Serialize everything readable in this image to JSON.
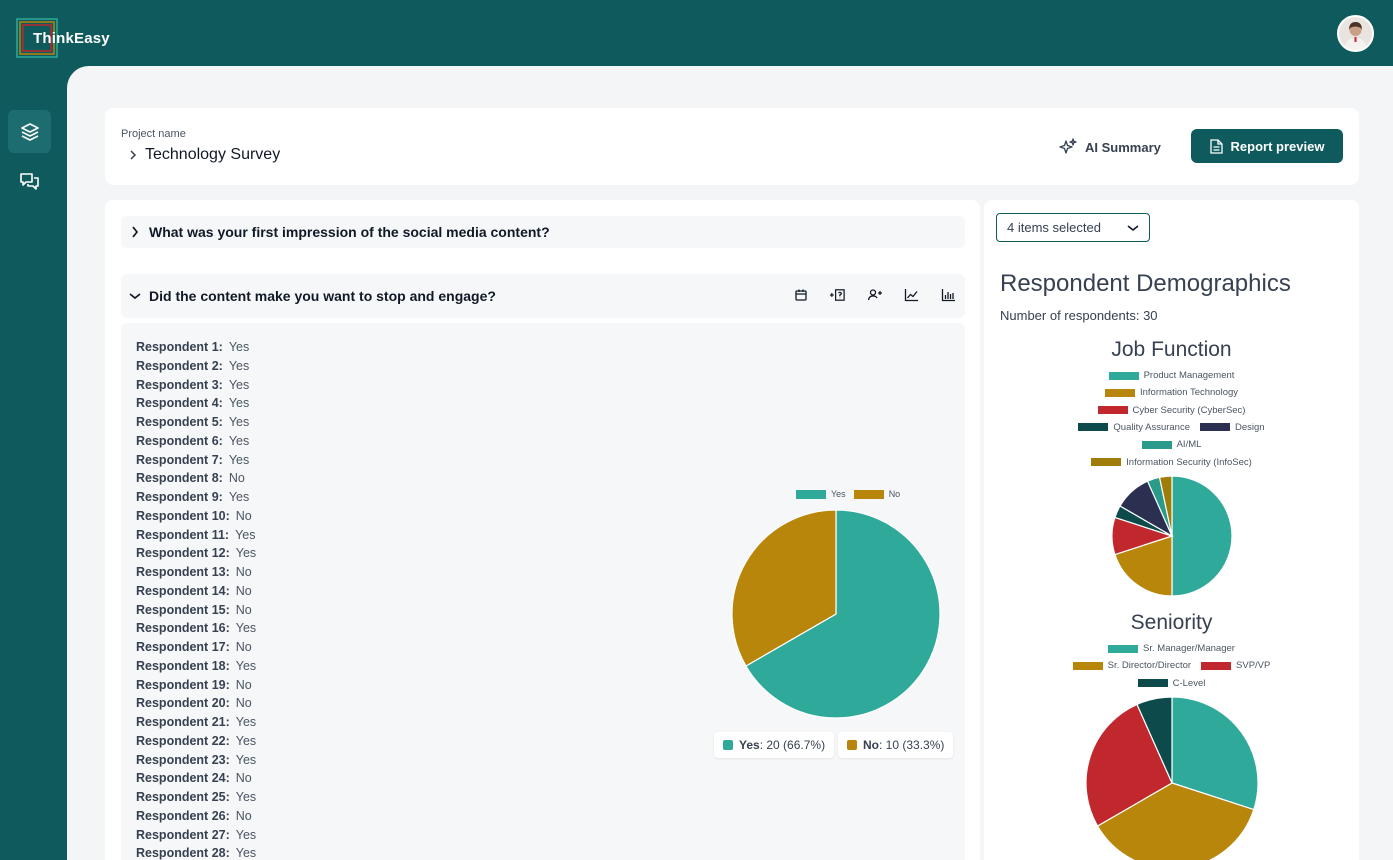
{
  "app": {
    "name": "ThinkEasy"
  },
  "project": {
    "label": "Project name",
    "name": "Technology Survey"
  },
  "actions": {
    "ai_summary": "AI Summary",
    "report_preview": "Report preview"
  },
  "questions": [
    {
      "text": "What was your first impression of the social media content?",
      "expanded": false
    },
    {
      "text": "Did the content make you want to stop and engage?",
      "expanded": true
    }
  ],
  "question_tools": [
    "calendar-icon",
    "insert-question-icon",
    "respondent-icon",
    "line-chart-icon",
    "bar-chart-icon"
  ],
  "responses": [
    {
      "label": "Respondent 1:",
      "value": "Yes"
    },
    {
      "label": "Respondent 2:",
      "value": "Yes"
    },
    {
      "label": "Respondent 3:",
      "value": "Yes"
    },
    {
      "label": "Respondent 4:",
      "value": "Yes"
    },
    {
      "label": "Respondent 5:",
      "value": "Yes"
    },
    {
      "label": "Respondent 6:",
      "value": "Yes"
    },
    {
      "label": "Respondent 7:",
      "value": "Yes"
    },
    {
      "label": "Respondent 8:",
      "value": "No"
    },
    {
      "label": "Respondent 9:",
      "value": "Yes"
    },
    {
      "label": "Respondent 10:",
      "value": "No"
    },
    {
      "label": "Respondent 11:",
      "value": "Yes"
    },
    {
      "label": "Respondent 12:",
      "value": "Yes"
    },
    {
      "label": "Respondent 13:",
      "value": "No"
    },
    {
      "label": "Respondent 14:",
      "value": "No"
    },
    {
      "label": "Respondent 15:",
      "value": "No"
    },
    {
      "label": "Respondent 16:",
      "value": "Yes"
    },
    {
      "label": "Respondent 17:",
      "value": "No"
    },
    {
      "label": "Respondent 18:",
      "value": "Yes"
    },
    {
      "label": "Respondent 19:",
      "value": "No"
    },
    {
      "label": "Respondent 20:",
      "value": "No"
    },
    {
      "label": "Respondent 21:",
      "value": "Yes"
    },
    {
      "label": "Respondent 22:",
      "value": "Yes"
    },
    {
      "label": "Respondent 23:",
      "value": "Yes"
    },
    {
      "label": "Respondent 24:",
      "value": "No"
    },
    {
      "label": "Respondent 25:",
      "value": "Yes"
    },
    {
      "label": "Respondent 26:",
      "value": "No"
    },
    {
      "label": "Respondent 27:",
      "value": "Yes"
    },
    {
      "label": "Respondent 28:",
      "value": "Yes"
    }
  ],
  "summary_pills": [
    {
      "label": "Yes",
      "text": ": 20 (66.7%)",
      "color": "#2fa99a"
    },
    {
      "label": "No",
      "text": ": 10 (33.3%)",
      "color": "#b8860b"
    }
  ],
  "filter": {
    "selected": "4 items selected"
  },
  "demographics": {
    "title": "Respondent Demographics",
    "count_text": "Number of respondents: 30"
  },
  "chart_data": [
    {
      "type": "pie",
      "title": "",
      "categories": [
        "Yes",
        "No"
      ],
      "values": [
        20,
        10
      ],
      "colors": [
        "#2fa99a",
        "#b8860b"
      ],
      "legend": "top"
    },
    {
      "type": "pie",
      "title": "Job Function",
      "categories": [
        "Product Management",
        "Information Technology",
        "Cyber Security (CyberSec)",
        "Quality Assurance",
        "Design",
        "AI/ML",
        "Information Security (InfoSec)"
      ],
      "values": [
        15,
        6,
        3,
        1,
        3,
        1,
        1
      ],
      "colors": [
        "#2fa99a",
        "#b8860b",
        "#c0282d",
        "#0d4a4c",
        "#2b3050",
        "#2a9a8a",
        "#a07d0a"
      ],
      "legend": "top"
    },
    {
      "type": "pie",
      "title": "Seniority",
      "categories": [
        "Sr. Manager/Manager",
        "Sr. Director/Director",
        "SVP/VP",
        "C-Level"
      ],
      "values": [
        9,
        11,
        8,
        2
      ],
      "colors": [
        "#2fa99a",
        "#b8860b",
        "#c0282d",
        "#0d4a4c"
      ],
      "legend": "top"
    }
  ]
}
